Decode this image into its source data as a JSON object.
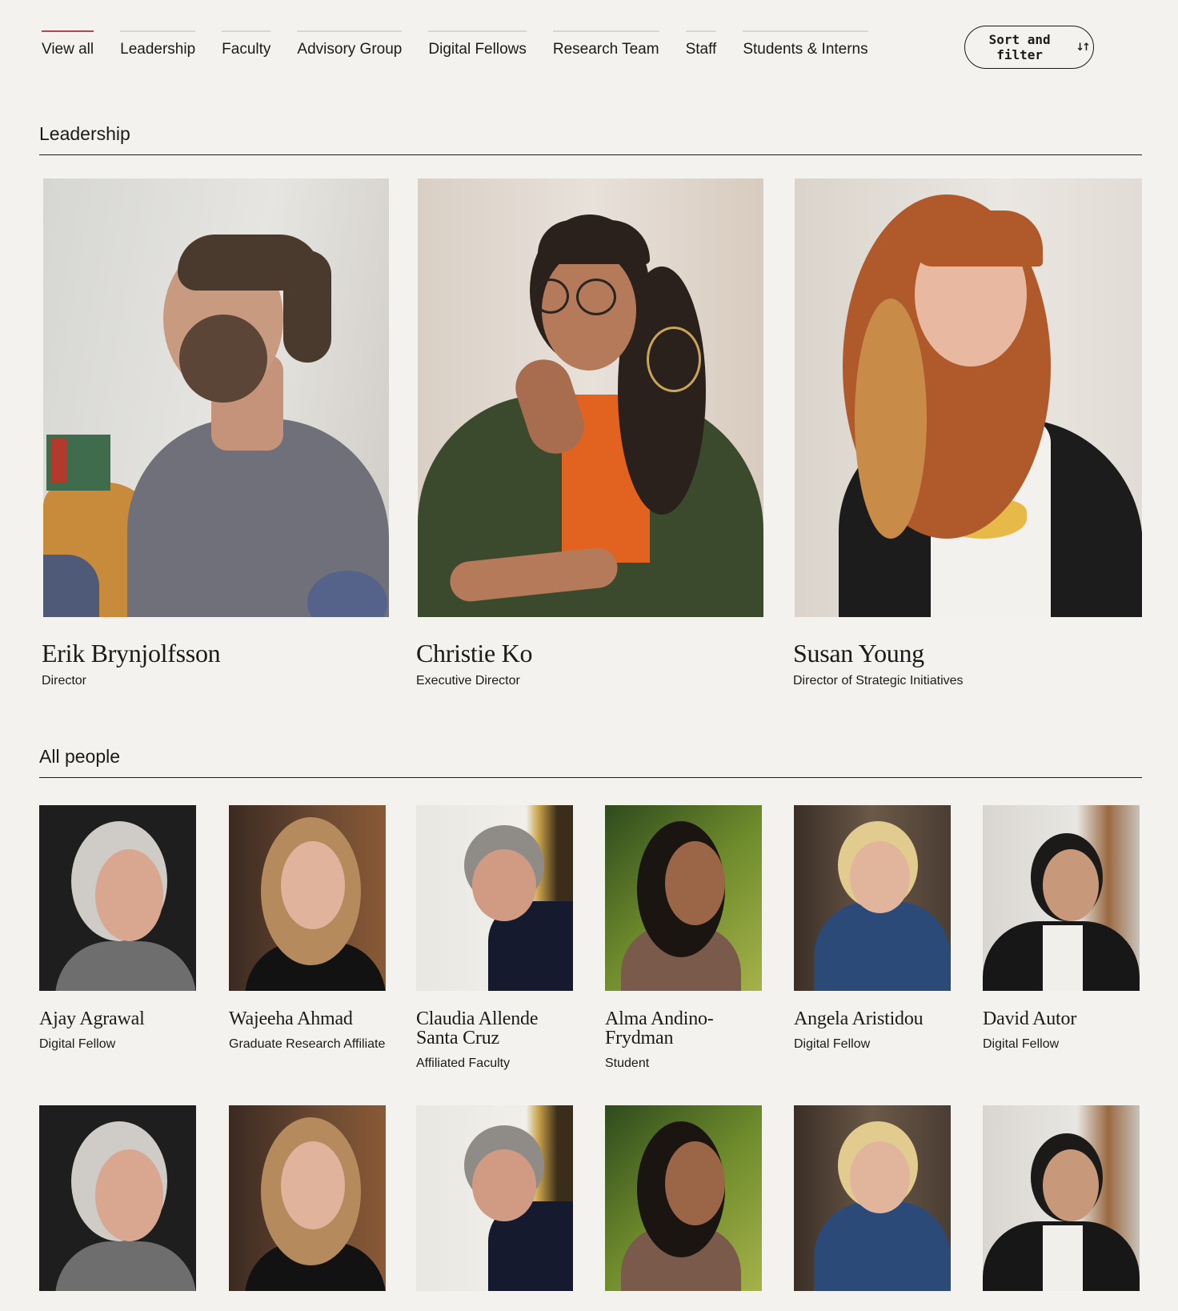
{
  "nav": {
    "tabs": [
      {
        "label": "View all",
        "active": true
      },
      {
        "label": "Leadership",
        "active": false
      },
      {
        "label": "Faculty",
        "active": false
      },
      {
        "label": "Advisory Group",
        "active": false
      },
      {
        "label": "Digital Fellows",
        "active": false
      },
      {
        "label": "Research Team",
        "active": false
      },
      {
        "label": "Staff",
        "active": false
      },
      {
        "label": "Students & Interns",
        "active": false
      }
    ],
    "sort_label": "Sort and filter",
    "sort_icon": "sort-arrows-icon"
  },
  "sections": {
    "leadership": "Leadership",
    "all_people": "All people"
  },
  "leaders": [
    {
      "name": "Erik Brynjolfsson",
      "title": "Director"
    },
    {
      "name": "Christie Ko",
      "title": "Executive Director"
    },
    {
      "name": "Susan Young",
      "title": "Director of Strategic Initiatives"
    }
  ],
  "people": [
    {
      "name": "Ajay Agrawal",
      "role": "Digital Fellow"
    },
    {
      "name": "Wajeeha Ahmad",
      "role": "Graduate Research Affiliate"
    },
    {
      "name": "Claudia Allende Santa Cruz",
      "role": "Affiliated Faculty"
    },
    {
      "name": "Alma Andino-Frydman",
      "role": "Student"
    },
    {
      "name": "Angela Aristidou",
      "role": "Digital Fellow"
    },
    {
      "name": "David Autor",
      "role": "Digital Fellow"
    }
  ],
  "colors": {
    "background": "#f4f2ee",
    "text": "#1b1b1b",
    "active_tab": "#b5484d",
    "tab_rule": "#d9d6d1"
  }
}
